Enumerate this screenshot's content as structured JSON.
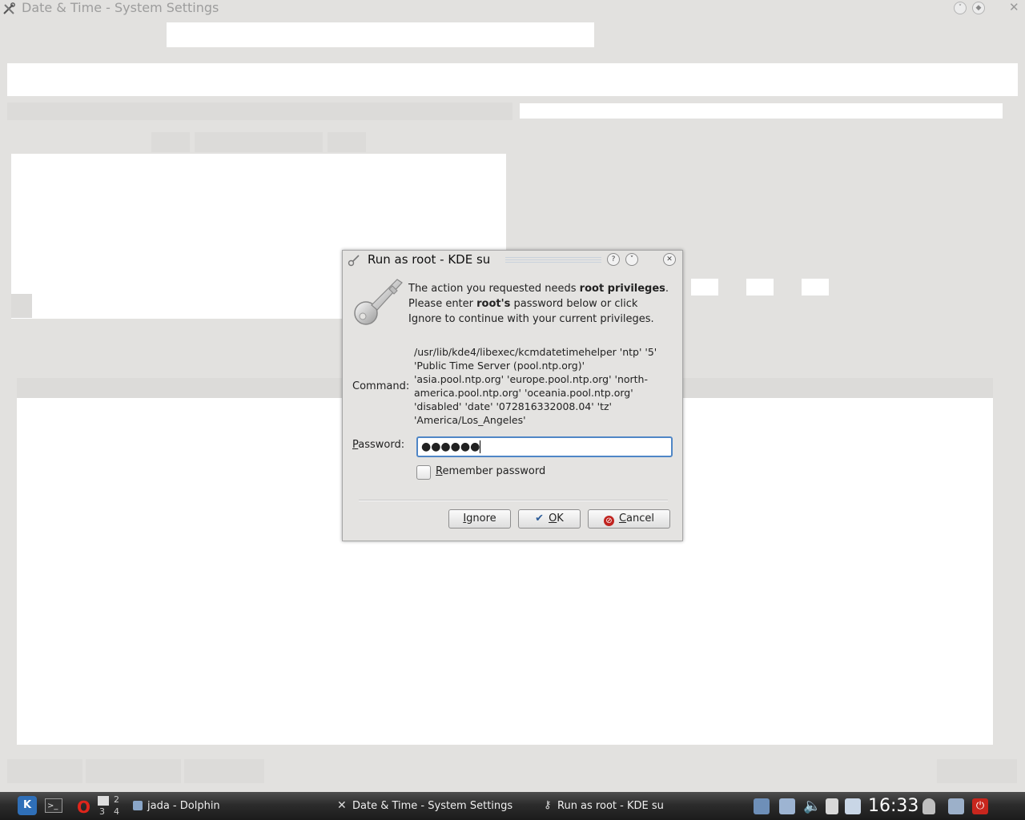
{
  "background_window": {
    "title": "Date & Time - System Settings",
    "icon": "tools-icon"
  },
  "dialog": {
    "title": "Run as root - KDE su",
    "icon": "key-icon",
    "titlebar_buttons": [
      "help-icon",
      "minimize-icon",
      "close-icon"
    ],
    "message": {
      "part1": "The action you requested needs ",
      "bold1": "root privileges",
      "part2": ". Please enter ",
      "bold2": "root's",
      "part3": " password below or click Ignore to continue with your current privileges."
    },
    "command_label": "Command:",
    "command_text": "/usr/lib/kde4/libexec/kcmdatetimehelper 'ntp' '5' 'Public Time Server (pool.ntp.org)' 'asia.pool.ntp.org' 'europe.pool.ntp.org' 'north-america.pool.ntp.org' 'oceania.pool.ntp.org' 'disabled' 'date' '072816332008.04' 'tz' 'America/Los_Angeles'",
    "password_label": "Password:",
    "password_value": "●●●●●●",
    "remember_label": "Remember password",
    "remember_checked": false,
    "buttons": {
      "ignore": "Ignore",
      "ok": "OK",
      "cancel": "Cancel"
    }
  },
  "taskbar": {
    "pager": [
      "1",
      "2",
      "3",
      "4"
    ],
    "tasks": [
      {
        "label": "jada - Dolphin",
        "icon": "folder-icon"
      },
      {
        "label": "Date & Time - System Settings",
        "icon": "tools-icon"
      },
      {
        "label": "Run as root - KDE su",
        "icon": "key-icon"
      }
    ],
    "clock": "16:33"
  }
}
